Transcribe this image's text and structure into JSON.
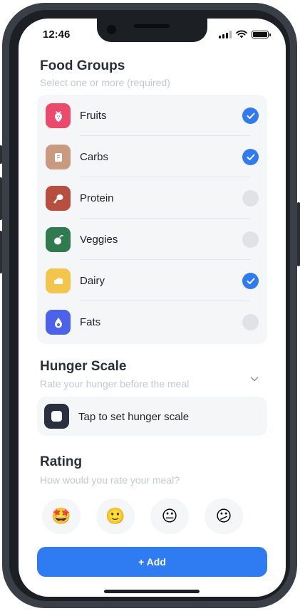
{
  "status_bar": {
    "time": "12:46"
  },
  "food_groups": {
    "title": "Food Groups",
    "subtitle": "Select one or more (required)",
    "items": [
      {
        "label": "Fruits",
        "icon": "strawberry-icon",
        "color": "#ec4a6a",
        "checked": true
      },
      {
        "label": "Carbs",
        "icon": "bread-icon",
        "color": "#c99a7e",
        "checked": true
      },
      {
        "label": "Protein",
        "icon": "drumstick-icon",
        "color": "#b84e3e",
        "checked": false
      },
      {
        "label": "Veggies",
        "icon": "vegetable-icon",
        "color": "#2f7a4e",
        "checked": false
      },
      {
        "label": "Dairy",
        "icon": "cheese-icon",
        "color": "#f2c64a",
        "checked": true
      },
      {
        "label": "Fats",
        "icon": "avocado-icon",
        "color": "#4a63e8",
        "checked": false
      }
    ]
  },
  "hunger_scale": {
    "title": "Hunger Scale",
    "subtitle": "Rate your hunger before the meal",
    "button_label": "Tap to set hunger scale"
  },
  "rating": {
    "title": "Rating",
    "subtitle": "How would you rate your meal?",
    "options": [
      "🤩",
      "🙂",
      "😐",
      "😕"
    ]
  },
  "add_button": {
    "label": "+ Add"
  },
  "colors": {
    "accent": "#2f7bf2"
  }
}
